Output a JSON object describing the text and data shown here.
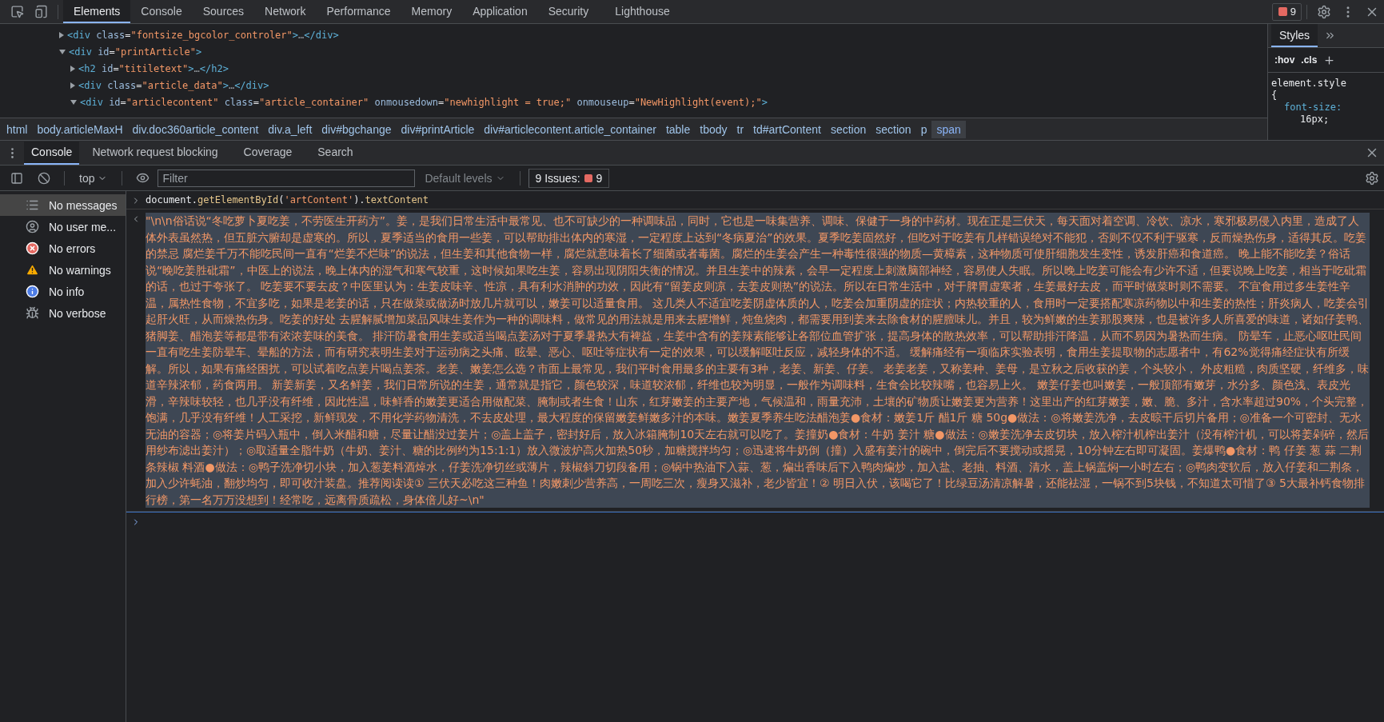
{
  "top_tabs": [
    {
      "label": "Elements",
      "selected": true
    },
    {
      "label": "Console",
      "selected": false
    },
    {
      "label": "Sources",
      "selected": false
    },
    {
      "label": "Network",
      "selected": false
    },
    {
      "label": "Performance",
      "selected": false
    },
    {
      "label": "Memory",
      "selected": false
    },
    {
      "label": "Application",
      "selected": false
    },
    {
      "label": "Security",
      "selected": false
    },
    {
      "label": "Lighthouse",
      "selected": false
    }
  ],
  "error_count": "9",
  "dom_tree": [
    {
      "expanded": false,
      "tokens": [
        {
          "kind": "tag",
          "text": "<div"
        },
        {
          "kind": "attr",
          "text": " class"
        },
        {
          "kind": "eq",
          "text": "="
        },
        {
          "kind": "value",
          "text": "\"fontsize_bgcolor_controler\""
        },
        {
          "kind": "tag",
          "text": ">"
        },
        {
          "kind": "ellipsis",
          "text": "…"
        },
        {
          "kind": "tag",
          "text": "</div>"
        }
      ]
    },
    {
      "expanded": true,
      "tokens": [
        {
          "kind": "tag",
          "text": "<div"
        },
        {
          "kind": "attr",
          "text": " id"
        },
        {
          "kind": "eq",
          "text": "="
        },
        {
          "kind": "value",
          "text": "\"printArticle\""
        },
        {
          "kind": "tag",
          "text": ">"
        }
      ],
      "children": [
        {
          "expanded": false,
          "tokens": [
            {
              "kind": "tag",
              "text": "<h2"
            },
            {
              "kind": "attr",
              "text": " id"
            },
            {
              "kind": "eq",
              "text": "="
            },
            {
              "kind": "value",
              "text": "\"titiletext\""
            },
            {
              "kind": "tag",
              "text": ">"
            },
            {
              "kind": "ellipsis",
              "text": "…"
            },
            {
              "kind": "tag",
              "text": "</h2>"
            }
          ]
        },
        {
          "expanded": false,
          "tokens": [
            {
              "kind": "tag",
              "text": "<div"
            },
            {
              "kind": "attr",
              "text": " class"
            },
            {
              "kind": "eq",
              "text": "="
            },
            {
              "kind": "value",
              "text": "\"article_data\""
            },
            {
              "kind": "tag",
              "text": ">"
            },
            {
              "kind": "ellipsis",
              "text": "…"
            },
            {
              "kind": "tag",
              "text": "</div>"
            }
          ]
        },
        {
          "expanded": true,
          "tokens": [
            {
              "kind": "tag",
              "text": "<div"
            },
            {
              "kind": "attr",
              "text": " id"
            },
            {
              "kind": "eq",
              "text": "="
            },
            {
              "kind": "value",
              "text": "\"articlecontent\""
            },
            {
              "kind": "attr",
              "text": " class"
            },
            {
              "kind": "eq",
              "text": "="
            },
            {
              "kind": "value",
              "text": "\"article_container\""
            },
            {
              "kind": "attr",
              "text": " onmousedown"
            },
            {
              "kind": "eq",
              "text": "="
            },
            {
              "kind": "value",
              "text": "\"newhighlight = true;\""
            },
            {
              "kind": "attr",
              "text": " onmouseup"
            },
            {
              "kind": "eq",
              "text": "="
            },
            {
              "kind": "value",
              "text": "\"NewHighlight(event);\""
            },
            {
              "kind": "tag",
              "text": ">"
            }
          ]
        }
      ]
    }
  ],
  "breadcrumbs": [
    {
      "label": "html",
      "selected": false
    },
    {
      "label": "body.articleMaxH",
      "selected": false
    },
    {
      "label": "div.doc360article_content",
      "selected": false
    },
    {
      "label": "div.a_left",
      "selected": false
    },
    {
      "label": "div#bgchange",
      "selected": false
    },
    {
      "label": "div#printArticle",
      "selected": false
    },
    {
      "label": "div#articlecontent.article_container",
      "selected": false
    },
    {
      "label": "table",
      "selected": false
    },
    {
      "label": "tbody",
      "selected": false
    },
    {
      "label": "tr",
      "selected": false
    },
    {
      "label": "td#artContent",
      "selected": false
    },
    {
      "label": "section",
      "selected": false
    },
    {
      "label": "section",
      "selected": false
    },
    {
      "label": "p",
      "selected": false
    },
    {
      "label": "span",
      "selected": true
    }
  ],
  "styles_pane": {
    "tabs": [
      {
        "label": "Styles",
        "selected": true
      }
    ],
    "hov": ":hov",
    "cls": ".cls",
    "selector": "element.style {",
    "property": "font-size:",
    "value": "16px;"
  },
  "drawer_tabs": [
    {
      "label": "Console",
      "selected": true
    },
    {
      "label": "Network request blocking",
      "selected": false
    },
    {
      "label": "Coverage",
      "selected": false
    },
    {
      "label": "Search",
      "selected": false
    }
  ],
  "toolbar": {
    "context": "top",
    "filter_placeholder": "Filter",
    "levels": "Default levels",
    "issues_label": "9 Issues:",
    "issues_count": "9"
  },
  "sidebar": [
    {
      "kind": "messages",
      "label": "No messages",
      "selected": true
    },
    {
      "kind": "user",
      "label": "No user me...",
      "selected": false
    },
    {
      "kind": "errors",
      "label": "No errors",
      "selected": false
    },
    {
      "kind": "warnings",
      "label": "No warnings",
      "selected": false
    },
    {
      "kind": "info",
      "label": "No info",
      "selected": false
    },
    {
      "kind": "verbose",
      "label": "No verbose",
      "selected": false
    }
  ],
  "console": {
    "input_tokens": [
      {
        "kind": "plain",
        "text": "document"
      },
      {
        "kind": "plain",
        "text": "."
      },
      {
        "kind": "method",
        "text": "getElementById"
      },
      {
        "kind": "plain",
        "text": "("
      },
      {
        "kind": "string",
        "text": "'artContent'"
      },
      {
        "kind": "plain",
        "text": ")."
      },
      {
        "kind": "method",
        "text": "textContent"
      }
    ],
    "output": "\"\\n\\n俗话说“冬吃萝卜夏吃姜，不劳医生开药方”。姜，是我们日常生活中最常见、也不可缺少的一种调味品，同时，它也是一味集营养、调味、保健于一身的中药材。现在正是三伏天，每天面对着空调、冷饮、凉水，寒邪极易侵入内里，造成了人体外表虽然热，但五脏六腑却是虚寒的。所以，夏季适当的食用一些姜，可以帮助排出体内的寒湿，一定程度上达到“冬病夏治”的效果。夏季吃姜固然好，但吃对于吃姜有几样错误绝对不能犯，否则不仅不利于驱寒，反而燥热伤身，适得其反。吃姜的禁忌   腐烂姜千万不能吃民间一直有“烂姜不烂味”的说法，但生姜和其他食物一样，腐烂就意味着长了细菌或者毒菌。腐烂的生姜会产生一种毒性很强的物质—黄樟素，这种物质可使肝细胞发生变性，诱发肝癌和食道癌。   晚上能不能吃姜？俗话说“晚吃姜胜砒霜”，中医上的说法，晚上体内的湿气和寒气较重，这时候如果吃生姜，容易出现阴阳失衡的情况。并且生姜中的辣素，会早一定程度上刺激脑部神经，容易使人失眠。所以晚上吃姜可能会有少许不适，但要说晚上吃姜，相当于吃砒霜的话，也过于夸张了。   吃姜要不要去皮？中医里认为：生姜皮味辛、性凉，具有利水消肿的功效，因此有“留姜皮则凉，去姜皮则热”的说法。所以在日常生活中，对于脾胃虚寒者，生姜最好去皮，而平时做菜时则不需要。   不宜食用过多生姜性辛温，属热性食物，不宜多吃，如果是老姜的话，只在做菜或做汤时放几片就可以，嫩姜可以适量食用。   这几类人不适宜吃姜阴虚体质的人，吃姜会加重阴虚的症状；内热较重的人，食用时一定要搭配寒凉药物以中和生姜的热性；肝炎病人，吃姜会引起肝火旺，从而燥热伤身。吃姜的好处   去腥解腻增加菜品风味生姜作为一种的调味料，做常见的用法就是用来去腥增鲜，炖鱼烧肉，都需要用到姜来去除食材的腥膻味儿。并且，较为鲜嫩的生姜那股爽辣，也是被许多人所喜爱的味道，诸如仔姜鸭、猪脚姜、醋泡姜等都是带有浓浓姜味的美食。   排汗防暑食用生姜或适当喝点姜汤对于夏季暑热大有裨益，生姜中含有的姜辣素能够让各部位血管扩张，提高身体的散热效率，可以帮助排汗降温，从而不易因为暑热而生病。   防晕车，止恶心呕吐民间一直有吃生姜防晕车、晕船的方法，而有研究表明生姜对于运动病之头痛、眩晕、恶心、呕吐等症状有一定的效果，可以缓解呕吐反应，减轻身体的不适。   缓解痛经有一项临床实验表明，食用生姜提取物的志愿者中，有62%觉得痛经症状有所缓解。所以，如果有痛经困扰，可以试着吃点姜片喝点姜茶。老姜、嫩姜怎么选？市面上最常见，我们平时食用最多的主要有3种，老姜、新姜、仔姜。   老姜老姜，又称姜种、姜母，是立秋之后收获的姜，个头较小， 外皮粗糙，肉质坚硬，纤维多，味道辛辣浓郁，药食两用。   新姜新姜，又名鲜姜，我们日常所说的生姜，通常就是指它，颜色较深，味道较浓郁，纤维也较为明显，一般作为调味料，生食会比较辣嘴，也容易上火。   嫩姜仔姜也叫嫩姜，一般顶部有嫩芽，水分多、颜色浅、表皮光滑，辛辣味较轻，也几乎没有纤维，因此性温，味鲜香的嫩姜更适合用做配菜、腌制或者生食！山东，红芽嫩姜的主要产地，气候温和，雨量充沛，土壤的矿物质让嫩姜更为营养！这里出产的红芽嫩姜，嫩、脆、多汁，含水率超过90%，个头完整，饱满，几乎没有纤维！人工采挖，新鲜现发，不用化学药物清洗，不去皮处理，最大程度的保留嫩姜鲜嫩多汁的本味。嫩姜夏季养生吃法醋泡姜●食材：嫩姜1斤  醋1斤  糖  50g●做法：◎将嫩姜洗净，去皮晾干后切片备用；◎准备一个可密封、无水无油的容器；◎将姜片码入瓶中，倒入米醋和糖，尽量让醋没过姜片；◎盖上盖子，密封好后，放入冰箱腌制10天左右就可以吃了。姜撞奶●食材：牛奶  姜汁  糖●做法：◎嫩姜洗净去皮切块，放入榨汁机榨出姜汁（没有榨汁机，可以将姜剁碎，然后用纱布滤出姜汁）；◎取适量全脂牛奶（牛奶、姜汁、糖的比例约为15:1:1）放入微波炉高火加热50秒，加糖搅拌均匀；◎迅速将牛奶倒（撞）入盛有姜汁的碗中，倒完后不要搅动或摇晃，10分钟左右即可凝固。姜爆鸭●食材：鸭  仔姜  葱  蒜  二荆条辣椒  料酒●做法：◎鸭子洗净切小块，加入葱姜料酒焯水，仔姜洗净切丝或薄片，辣椒斜刀切段备用；◎锅中热油下入蒜、葱，煸出香味后下入鸭肉煸炒，加入盐、老抽、料酒、清水，盖上锅盖焖一小时左右；◎鸭肉变软后，放入仔姜和二荆条，加入少许蚝油，翻炒均匀，即可收汁装盘。推荐阅读读① 三伏天必吃这三种鱼！肉嫩刺少营养高，一周吃三次，瘦身又滋补，老少皆宜！② 明日入伏，该喝它了！比绿豆汤清凉解暑，还能祛湿，一锅不到5块钱，不知道太可惜了③ 5大最补钙食物排行榜，第一名万万没想到！经常吃，远离骨质疏松，身体倍儿好~\\n\""
  }
}
